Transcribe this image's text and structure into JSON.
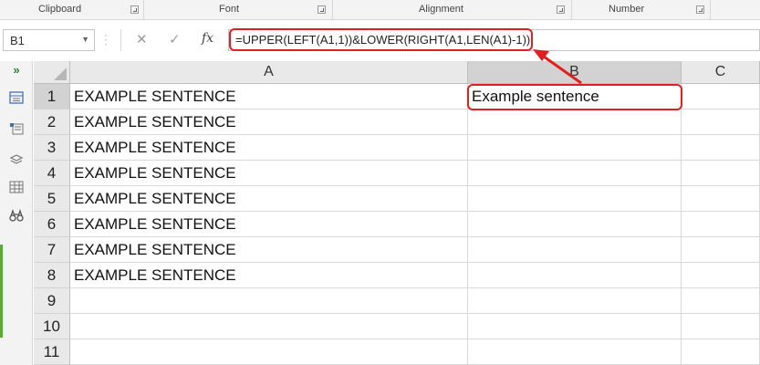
{
  "ribbon": {
    "groups": [
      {
        "label": "Clipboard"
      },
      {
        "label": "Font"
      },
      {
        "label": "Alignment"
      },
      {
        "label": "Number"
      }
    ]
  },
  "namebox": {
    "value": "B1"
  },
  "formula_bar": {
    "cancel_icon": "✕",
    "enter_icon": "✓",
    "fx_label": "fx",
    "formula": "=UPPER(LEFT(A1,1))&LOWER(RIGHT(A1,LEN(A1)-1))"
  },
  "columns": [
    "A",
    "B",
    "C"
  ],
  "rows": [
    {
      "num": "1",
      "a": "EXAMPLE SENTENCE",
      "b": "Example sentence"
    },
    {
      "num": "2",
      "a": "EXAMPLE SENTENCE",
      "b": ""
    },
    {
      "num": "3",
      "a": "EXAMPLE SENTENCE",
      "b": ""
    },
    {
      "num": "4",
      "a": "EXAMPLE SENTENCE",
      "b": ""
    },
    {
      "num": "5",
      "a": "EXAMPLE SENTENCE",
      "b": ""
    },
    {
      "num": "6",
      "a": "EXAMPLE SENTENCE",
      "b": ""
    },
    {
      "num": "7",
      "a": "EXAMPLE SENTENCE",
      "b": ""
    },
    {
      "num": "8",
      "a": "EXAMPLE SENTENCE",
      "b": ""
    },
    {
      "num": "9",
      "a": "",
      "b": ""
    },
    {
      "num": "10",
      "a": "",
      "b": ""
    },
    {
      "num": "11",
      "a": "",
      "b": ""
    }
  ],
  "colors": {
    "annotation": "#e02020",
    "status_green": "#5aa83a"
  },
  "rail_icons": [
    "expand-icon",
    "form-icon",
    "list-icon",
    "stack-icon",
    "table-icon",
    "binoculars-icon"
  ]
}
